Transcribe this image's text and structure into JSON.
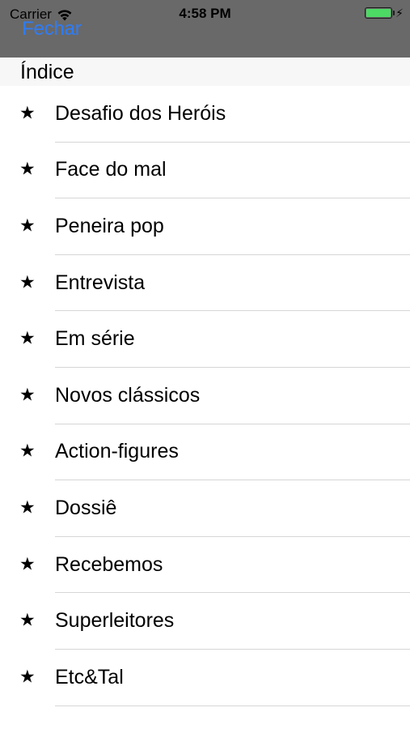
{
  "status_bar": {
    "carrier": "Carrier",
    "time": "4:58 PM",
    "battery_level": 1.0,
    "wifi_icon": "wifi-icon",
    "charging_icon": "bolt-icon"
  },
  "nav": {
    "close_label": "Fechar",
    "bar_color": "#696969",
    "accent_color": "#2f7cf6"
  },
  "section": {
    "title": "Índice"
  },
  "items": [
    {
      "label": "Desafio dos Heróis",
      "icon": "star-icon"
    },
    {
      "label": "Face do mal",
      "icon": "star-icon"
    },
    {
      "label": "Peneira pop",
      "icon": "star-icon"
    },
    {
      "label": "Entrevista",
      "icon": "star-icon"
    },
    {
      "label": "Em série",
      "icon": "star-icon"
    },
    {
      "label": "Novos clássicos",
      "icon": "star-icon"
    },
    {
      "label": "Action-figures",
      "icon": "star-icon"
    },
    {
      "label": "Dossiê",
      "icon": "star-icon"
    },
    {
      "label": "Recebemos",
      "icon": "star-icon"
    },
    {
      "label": "Superleitores",
      "icon": "star-icon"
    },
    {
      "label": "Etc&Tal",
      "icon": "star-icon"
    }
  ]
}
